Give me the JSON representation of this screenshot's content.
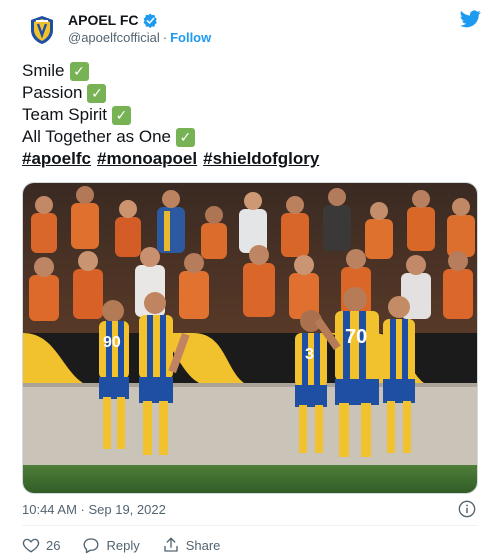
{
  "account": {
    "display_name": "APOEL FC",
    "handle": "@apoelfcofficial",
    "separator": "·",
    "follow_label": "Follow"
  },
  "tweet": {
    "lines": [
      {
        "text": "Smile"
      },
      {
        "text": "Passion"
      },
      {
        "text": "Team Spirit"
      },
      {
        "text": "All Together as One"
      }
    ],
    "hashtags": [
      "#apoelfc",
      "#monoapoel",
      "#shieldofglory"
    ]
  },
  "media": {
    "kits": [
      {
        "number": "70"
      },
      {
        "number": "90"
      },
      {
        "number": "3"
      }
    ]
  },
  "meta": {
    "timestamp": "10:44 AM · Sep 19, 2022"
  },
  "actions": {
    "like_count": "26",
    "reply_label": "Reply",
    "share_label": "Share"
  },
  "colors": {
    "accent": "#1d9bf0",
    "kit_yellow": "#f2c12e",
    "kit_blue": "#1f4fa3",
    "check_green": "#77b255"
  }
}
